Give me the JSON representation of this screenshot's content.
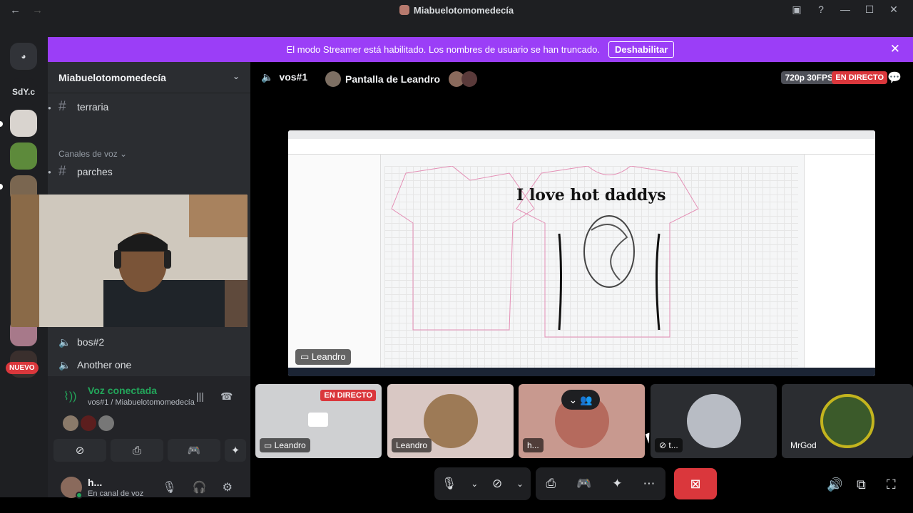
{
  "window": {
    "title": "Miabuelotomomedecía",
    "nav_back": "←",
    "nav_forward": "→"
  },
  "banner": {
    "text": "El modo Streamer está habilitado. Los nombres de usuario se han truncado.",
    "button": "Deshabilitar",
    "close": "✕"
  },
  "guilds": {
    "sdy_label": "SdY.c",
    "nuevo_badge": "NUEVO"
  },
  "sidebar": {
    "server_name": "Miabuelotomomedecía",
    "channels": {
      "terraria": "terraria",
      "parches": "parches",
      "bos2": "bos#2",
      "another": "Another one"
    },
    "category_voice": "Canales de voz ⌄"
  },
  "voice_panel": {
    "title": "Voz conectada",
    "subtitle": "vos#1 / Miabuelotomomedecía"
  },
  "user": {
    "name": "h...",
    "status": "En canal de voz"
  },
  "stage": {
    "voice_channel": "vos#1",
    "screen_title": "Pantalla de Leandro",
    "quality": "720p 30FPS",
    "live": "EN DIRECTO",
    "screenshare_label": "Leandro",
    "shirt_text": "I love hot daddys"
  },
  "tiles": [
    {
      "label": "Leandro",
      "live": "EN DIRECTO"
    },
    {
      "label": "Leandro"
    },
    {
      "label": "h..."
    },
    {
      "label": "t..."
    },
    {
      "label": "MrGod"
    }
  ],
  "colors": {
    "accent": "#9b3ef7",
    "live": "#da373c",
    "connected": "#23a55a"
  }
}
